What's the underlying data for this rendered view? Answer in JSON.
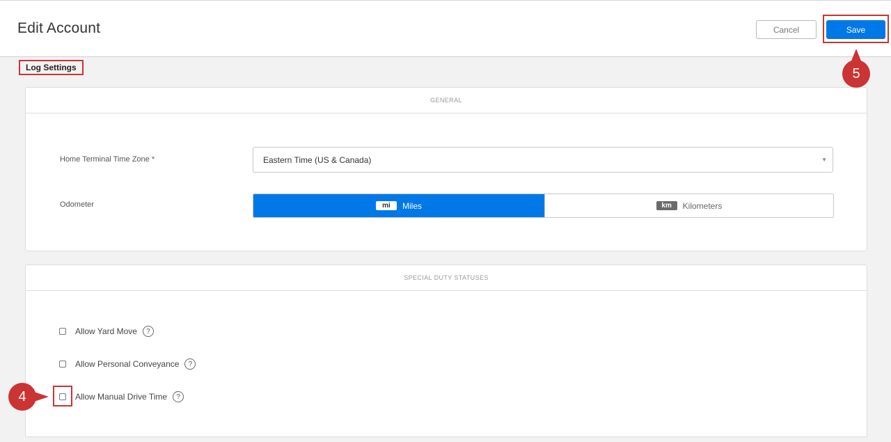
{
  "header": {
    "title": "Edit Account",
    "cancel_label": "Cancel",
    "save_label": "Save"
  },
  "section_heading": "Log Settings",
  "general": {
    "card_title": "GENERAL",
    "timezone_label": "Home Terminal Time Zone *",
    "timezone_value": "Eastern Time (US & Canada)",
    "odometer_label": "Odometer",
    "odometer_options": [
      {
        "badge": "mi",
        "label": "Miles",
        "selected": true
      },
      {
        "badge": "km",
        "label": "Kilometers",
        "selected": false
      }
    ]
  },
  "special": {
    "card_title": "SPECIAL DUTY STATUSES",
    "options": [
      {
        "label": "Allow Yard Move",
        "checked": false
      },
      {
        "label": "Allow Personal Conveyance",
        "checked": false
      },
      {
        "label": "Allow Manual Drive Time",
        "checked": false
      }
    ]
  },
  "annotations": {
    "marker_4": "4",
    "marker_5": "5",
    "color": "#cc3333"
  },
  "colors": {
    "accent": "#0078e7"
  },
  "icons": {
    "dropdown": "caret-down-icon",
    "help": "question-circle-icon"
  }
}
